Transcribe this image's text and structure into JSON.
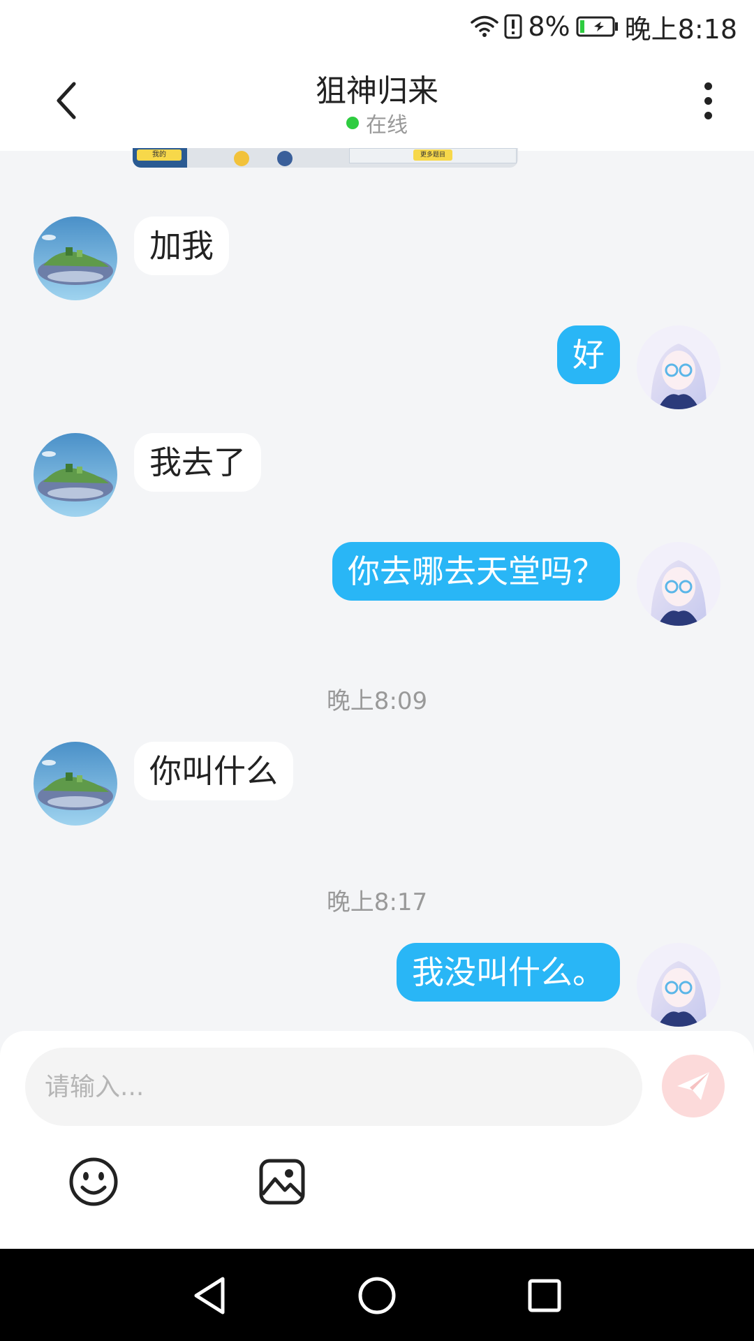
{
  "status_bar": {
    "battery_percent": "8%",
    "time": "晚上8:18",
    "icons": [
      "wifi-icon",
      "alert-icon",
      "battery-charging-icon"
    ]
  },
  "header": {
    "title": "狙神归来",
    "presence": "在线",
    "presence_color": "#2ecc40"
  },
  "messages": [
    {
      "side": "left",
      "text": "加我"
    },
    {
      "side": "right",
      "text": "好"
    },
    {
      "side": "left",
      "text": "我去了"
    },
    {
      "side": "right",
      "text": "你去哪去天堂吗？"
    },
    {
      "timestamp": "晚上8:09"
    },
    {
      "side": "left",
      "text": "你叫什么"
    },
    {
      "timestamp": "晚上8:17"
    },
    {
      "side": "right",
      "text": "我没叫什么。"
    }
  ],
  "chat": {
    "msg1": "加我",
    "msg2": "好",
    "msg3": "我去了",
    "msg4": "你去哪去天堂吗？",
    "time1": "晚上8:09",
    "msg5": "你叫什么",
    "time2": "晚上8:17",
    "msg6": "我没叫什么。"
  },
  "partial_image": {
    "tag_left": "我的",
    "tag_right": "更多题目"
  },
  "input": {
    "placeholder": "请输入...",
    "value": ""
  },
  "colors": {
    "outgoing_bubble": "#29b6f6",
    "incoming_bubble": "#ffffff",
    "background": "#f4f5f7",
    "send_button": "#fcdada"
  },
  "toolbar_icons": [
    "emoji-icon",
    "image-icon"
  ],
  "nav_icons": [
    "back-triangle-icon",
    "home-circle-icon",
    "recents-square-icon"
  ]
}
